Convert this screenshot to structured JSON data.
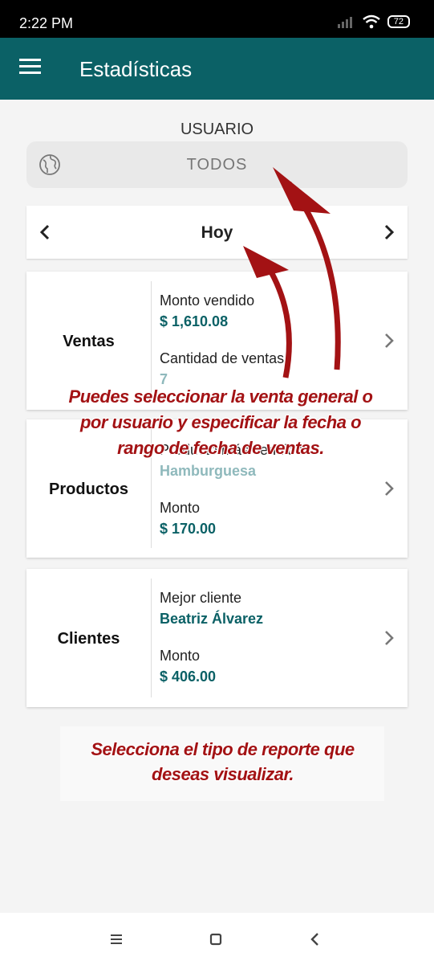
{
  "status_bar": {
    "time": "2:22 PM",
    "battery": "72"
  },
  "app_bar": {
    "title": "Estadísticas"
  },
  "user_filter": {
    "label": "USUARIO",
    "value": "TODOS"
  },
  "date_filter": {
    "value": "Hoy"
  },
  "cards": [
    {
      "title": "Ventas",
      "rows": [
        {
          "label": "Monto vendido",
          "value": "$ 1,610.08"
        },
        {
          "label": "Cantidad de ventas",
          "value": "7"
        }
      ]
    },
    {
      "title": "Productos",
      "rows": [
        {
          "label": "Producto más vendido",
          "value": "Hamburguesa"
        },
        {
          "label": "Monto",
          "value": "$ 170.00"
        }
      ]
    },
    {
      "title": "Clientes",
      "rows": [
        {
          "label": "Mejor cliente",
          "value": "Beatriz Álvarez"
        },
        {
          "label": "Monto",
          "value": "$ 406.00"
        }
      ]
    }
  ],
  "annotations": {
    "filter_hint": "Puedes seleccionar la venta general o por usuario y especificar la fecha o rango de fecha de ventas.",
    "report_hint": "Selecciona el tipo de reporte que deseas visualizar."
  },
  "colors": {
    "primary": "#0b6166",
    "annotation": "#a31214"
  },
  "icons": [
    "menu-icon",
    "globe-icon",
    "chevron-left-icon",
    "chevron-right-icon",
    "nav-menu-icon",
    "nav-home-icon",
    "nav-back-icon"
  ]
}
